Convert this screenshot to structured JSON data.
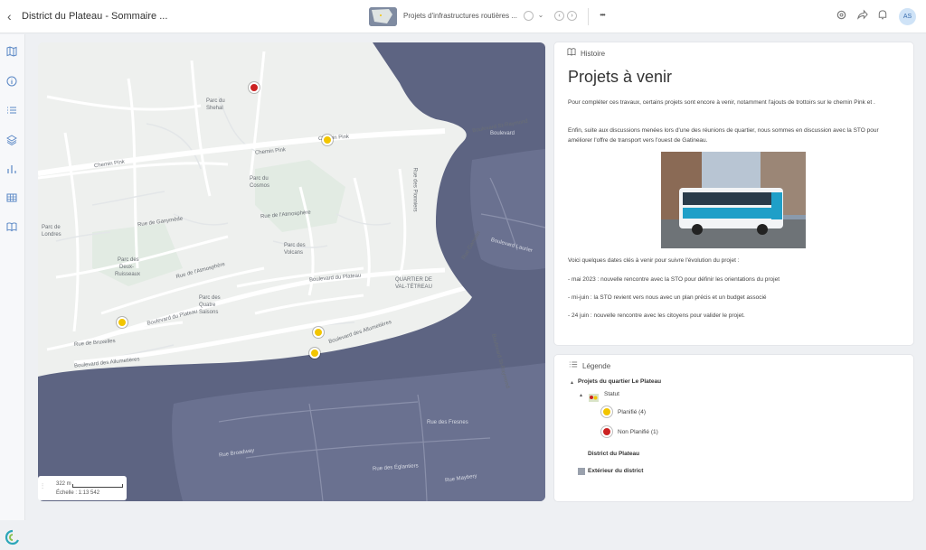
{
  "app": {
    "back_icon": "chevron-left-icon",
    "title": "District du Plateau - Sommaire ...",
    "story_title": "Projets d'infrastructures routières ..."
  },
  "toolbar": {
    "more": "•••",
    "avatar": "AS"
  },
  "map": {
    "labels": {
      "chemin_pink_1": "Chemin Pink",
      "chemin_pink_2": "Chemin Pink",
      "chemin_pink_3": "Chemin Pink",
      "bd_plateau_1": "Boulevard du Plateau",
      "bd_plateau_2": "Boulevard du Plateau",
      "bd_allumetieres_1": "Boulevard des Allumetières",
      "bd_allumetieres_2": "Boulevard des Allumetières",
      "atmosphere_1": "Rue de l'Atmosphère",
      "atmosphere_2": "Rue de l'Atmosphère",
      "ganymede": "Rue de Ganymède",
      "quartier": "QUARTIER DE",
      "quartier2": "VAL-TÉTREAU",
      "parc_deux": "Parc des",
      "parc_deux2": "Deux-",
      "parc_deux3": "Ruisseaux",
      "parc_quatre": "Parc des",
      "parc_quatre2": "Quatre",
      "parc_quatre3": "Saisons",
      "parc_londres": "Parc de",
      "parc_londres2": "Londres",
      "parc_shehal": "Parc du",
      "parc_shehal2": "Shehal",
      "parc_cosmos": "Parc du",
      "parc_cosmos2": "Cosmos",
      "parc_volcans": "Parc des",
      "parc_volcans2": "Volcans",
      "bruxelles": "Rue de Bruxelles",
      "bd_st_raymond": "Boulevard St-Raymond",
      "st_raymond2": "Boulevard St-Raymond",
      "premiers": "Rue des Pionniers",
      "gamelin": "Rue Gamelin",
      "laurier": "Boulevard Laurier",
      "fresnes": "Rue des Fresnes",
      "eglantiers": "Rue des Églantiers",
      "broadway": "Rue Broadway",
      "meybery": "Rue Maybery",
      "boulevard_label": "Boulevard"
    },
    "scale": {
      "distance": "322 m",
      "ratio": "Échelle : 1:13 542"
    }
  },
  "story": {
    "header": "Histoire",
    "title": "Projets à venir",
    "para1": "Pour compléter ces travaux, certains projets sont encore à venir, notamment l'ajouts de trottoirs sur le chemin Pink et .",
    "para2": "Enfin, suite aux discussions menées lors d'une des réunions de quartier, nous sommes en discussion avec la STO pour améliorer l'offre de transport vers l'ouest de Gatineau.",
    "para3": "Voici quelques dates clés à venir pour suivre l'évolution du projet :",
    "bullet1": "- mai 2023 : nouvelle rencontre avec la STO pour définir les orientations du projet",
    "bullet2": "- mi-juin : la STO revient vers nous avec un plan précis et un budget associé",
    "bullet3": "- 24 juin : nouvelle rencontre avec les citoyens pour valider le projet."
  },
  "legend": {
    "header": "Légende",
    "layer": "Projets du quartier Le Plateau",
    "statut": "Statut",
    "planifie": "Planifié (4)",
    "non_planifie": "Non Planifié (1)",
    "district": "District du Plateau",
    "exterieur": "Extérieur du district"
  },
  "colors": {
    "planifie": "#f2c500",
    "non_planifie": "#cc2222",
    "accent": "#5a87c5",
    "water": "#5d6482"
  }
}
